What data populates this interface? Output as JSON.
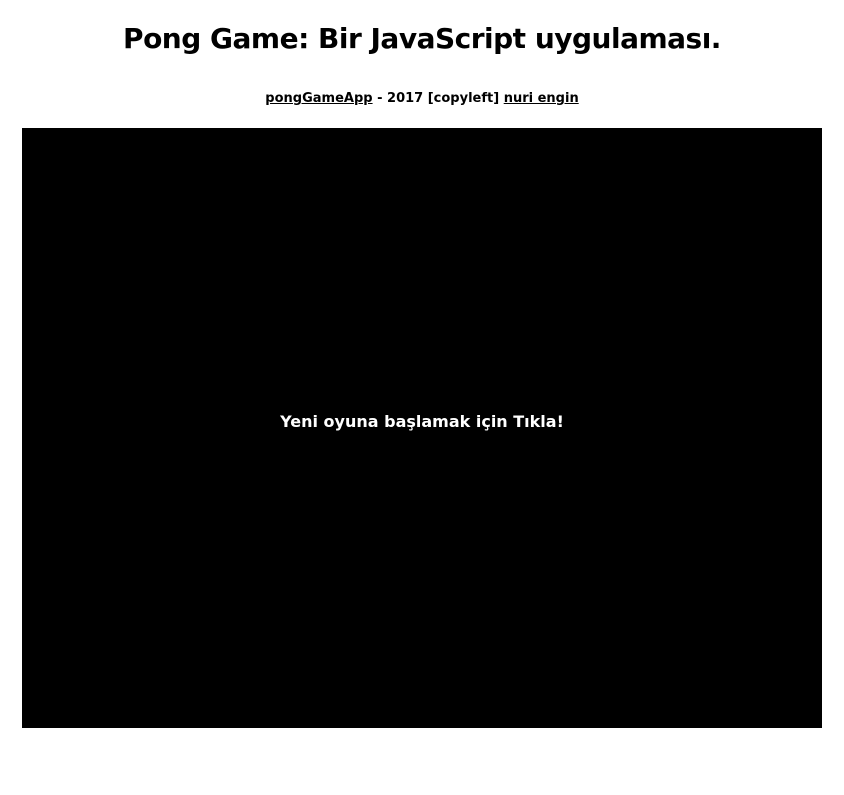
{
  "page": {
    "title": "Pong Game: Bir JavaScript uygulaması."
  },
  "credits": {
    "app_link": "pongGameApp",
    "middle_text": " - 2017 [copyleft] ",
    "author_link": "nuri engin"
  },
  "game": {
    "start_prompt": "Yeni oyuna başlamak için Tıkla!",
    "background_color": "#000000",
    "text_color": "#ffffff"
  }
}
